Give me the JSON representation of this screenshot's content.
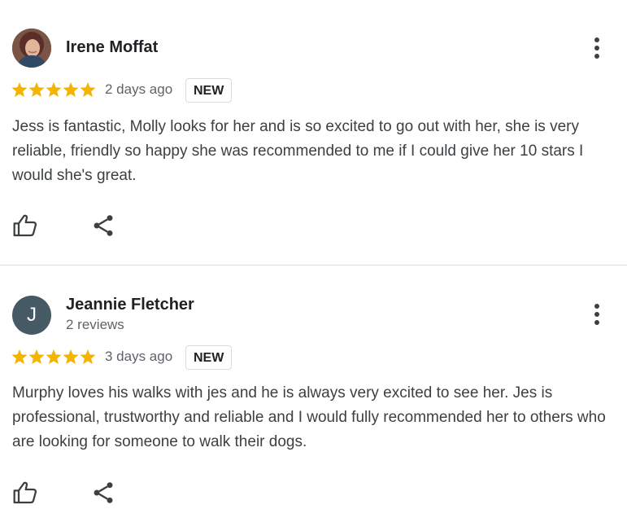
{
  "reviews": [
    {
      "reviewer_name": "Irene Moffat",
      "reviewer_meta": "",
      "avatar": {
        "type": "photo",
        "letter": ""
      },
      "rating": 5,
      "rating_max": 5,
      "date": "2 days ago",
      "badge": "NEW",
      "text": "Jess is fantastic, Molly looks for her and is so excited to go out with her, she is very reliable, friendly so happy she was recommended to me if I could give her 10 stars I would she's great.",
      "icons": {
        "more": "more-vert-icon",
        "like": "thumb-up-icon",
        "share": "share-icon"
      }
    },
    {
      "reviewer_name": "Jeannie Fletcher",
      "reviewer_meta": "2 reviews",
      "avatar": {
        "type": "letter",
        "letter": "J"
      },
      "rating": 5,
      "rating_max": 5,
      "date": "3 days ago",
      "badge": "NEW",
      "text": "Murphy loves his walks with jes and he is always very excited to see her. Jes is professional, trustworthy and reliable and I would fully recommended her to others who are looking for someone to walk their dogs.",
      "icons": {
        "more": "more-vert-icon",
        "like": "thumb-up-icon",
        "share": "share-icon"
      }
    }
  ],
  "colors": {
    "star": "#f4b400",
    "avatar_letter_bg": "#455a64",
    "text": "#3c4043",
    "meta": "#5f6368",
    "divider": "#dadce0"
  }
}
